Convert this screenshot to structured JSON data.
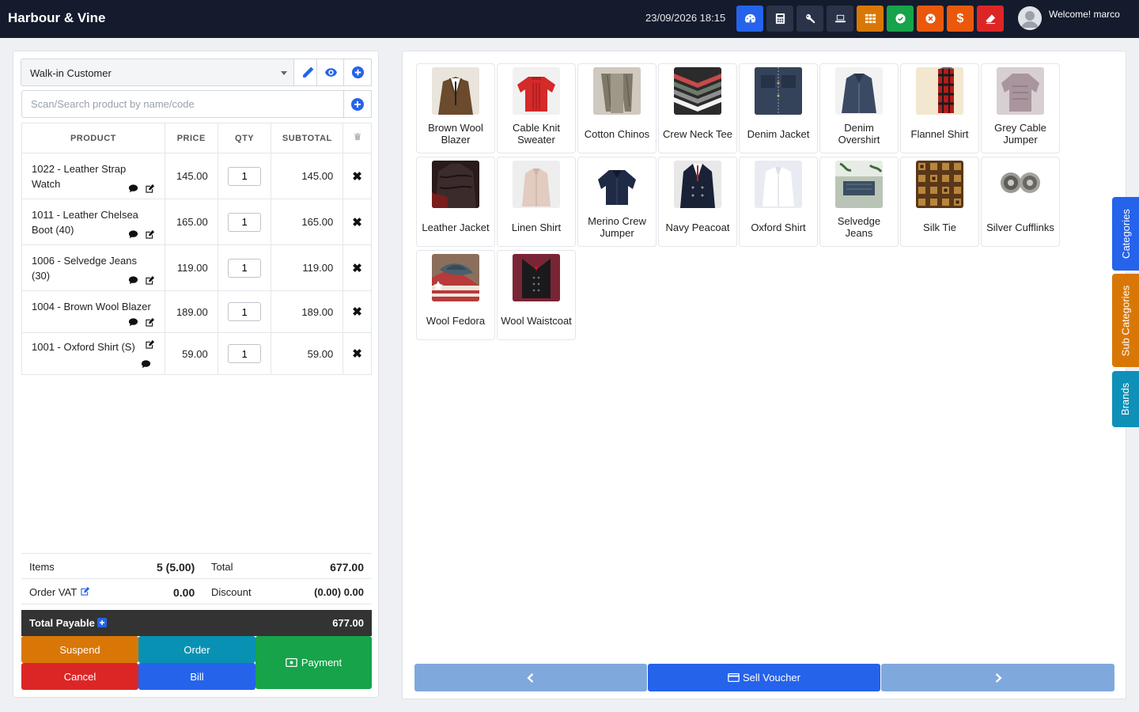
{
  "header": {
    "brand": "Harbour & Vine",
    "datetime": "23/09/2026 18:15",
    "welcome": "Welcome! marco",
    "buttons": [
      {
        "name": "dashboard",
        "icon": "dashboard-icon",
        "color": "#2563eb"
      },
      {
        "name": "calculator",
        "icon": "calculator-icon",
        "color": "#2a3347"
      },
      {
        "name": "shortcuts",
        "icon": "key-icon",
        "color": "#2a3347"
      },
      {
        "name": "fullscreen",
        "icon": "laptop-icon",
        "color": "#2a3347"
      },
      {
        "name": "register",
        "icon": "grid-icon",
        "color": "#d97706"
      },
      {
        "name": "today-sale",
        "icon": "check-circle-icon",
        "color": "#16a34a"
      },
      {
        "name": "close-register",
        "icon": "times-circle-icon",
        "color": "#ea580c"
      },
      {
        "name": "expense",
        "icon": "dollar-icon",
        "color": "#ea580c"
      },
      {
        "name": "clear",
        "icon": "eraser-icon",
        "color": "#dc2626"
      }
    ],
    "dollar_glyph": "$"
  },
  "customer": {
    "selected": "Walk-in Customer"
  },
  "search": {
    "placeholder": "Scan/Search product by name/code"
  },
  "cart": {
    "headers": {
      "product": "PRODUCT",
      "price": "PRICE",
      "qty": "QTY",
      "subtotal": "SUBTOTAL"
    },
    "rows": [
      {
        "product": "1022 - Leather Strap Watch",
        "price": "145.00",
        "qty": "1",
        "subtotal": "145.00"
      },
      {
        "product": "1011 - Leather Chelsea Boot (40)",
        "price": "165.00",
        "qty": "1",
        "subtotal": "165.00"
      },
      {
        "product": "1006 - Selvedge Jeans (30)",
        "price": "119.00",
        "qty": "1",
        "subtotal": "119.00"
      },
      {
        "product": "1004 - Brown Wool Blazer",
        "price": "189.00",
        "qty": "1",
        "subtotal": "189.00"
      },
      {
        "product": "1001 - Oxford Shirt (S)",
        "price": "59.00",
        "qty": "1",
        "subtotal": "59.00"
      }
    ]
  },
  "totals": {
    "items_label": "Items",
    "items_value": "5 (5.00)",
    "total_label": "Total",
    "total_value": "677.00",
    "vat_label": "Order VAT",
    "vat_value": "0.00",
    "discount_label": "Discount",
    "discount_value": "(0.00) 0.00",
    "payable_label": "Total Payable",
    "payable_value": "677.00"
  },
  "actions": {
    "suspend": "Suspend",
    "order": "Order",
    "payment": "Payment",
    "cancel": "Cancel",
    "bill": "Bill"
  },
  "products": [
    {
      "name": "Brown Wool Blazer",
      "thumb": "blazer"
    },
    {
      "name": "Cable Knit Sweater",
      "thumb": "sweater"
    },
    {
      "name": "Cotton Chinos",
      "thumb": "chinos"
    },
    {
      "name": "Crew Neck Tee",
      "thumb": "tees"
    },
    {
      "name": "Denim Jacket",
      "thumb": "denim"
    },
    {
      "name": "Denim Overshirt",
      "thumb": "overshirt"
    },
    {
      "name": "Flannel Shirt",
      "thumb": "flannel"
    },
    {
      "name": "Grey Cable Jumper",
      "thumb": "greyjumper"
    },
    {
      "name": "Leather Jacket",
      "thumb": "leather"
    },
    {
      "name": "Linen Shirt",
      "thumb": "linen"
    },
    {
      "name": "Merino Crew Jumper",
      "thumb": "merino"
    },
    {
      "name": "Navy Peacoat",
      "thumb": "peacoat"
    },
    {
      "name": "Oxford Shirt",
      "thumb": "oxford"
    },
    {
      "name": "Selvedge Jeans",
      "thumb": "jeans"
    },
    {
      "name": "Silk Tie",
      "thumb": "tie"
    },
    {
      "name": "Silver Cufflinks",
      "thumb": "cufflinks"
    },
    {
      "name": "Wool Fedora",
      "thumb": "fedora"
    },
    {
      "name": "Wool Waistcoat",
      "thumb": "waistcoat"
    }
  ],
  "pager": {
    "prev_icon": "chevron-left-icon",
    "voucher": "Sell Voucher",
    "next_icon": "chevron-right-icon"
  },
  "side_tabs": {
    "categories": "Categories",
    "sub_categories": "Sub Categories",
    "brands": "Brands"
  },
  "colors": {
    "header_bg": "#141b2d",
    "primary": "#2563eb",
    "suspend": "#d97706",
    "order": "#0891b2",
    "payment": "#16a34a",
    "cancel": "#dc2626",
    "pager_disabled": "#7fa9dc"
  }
}
